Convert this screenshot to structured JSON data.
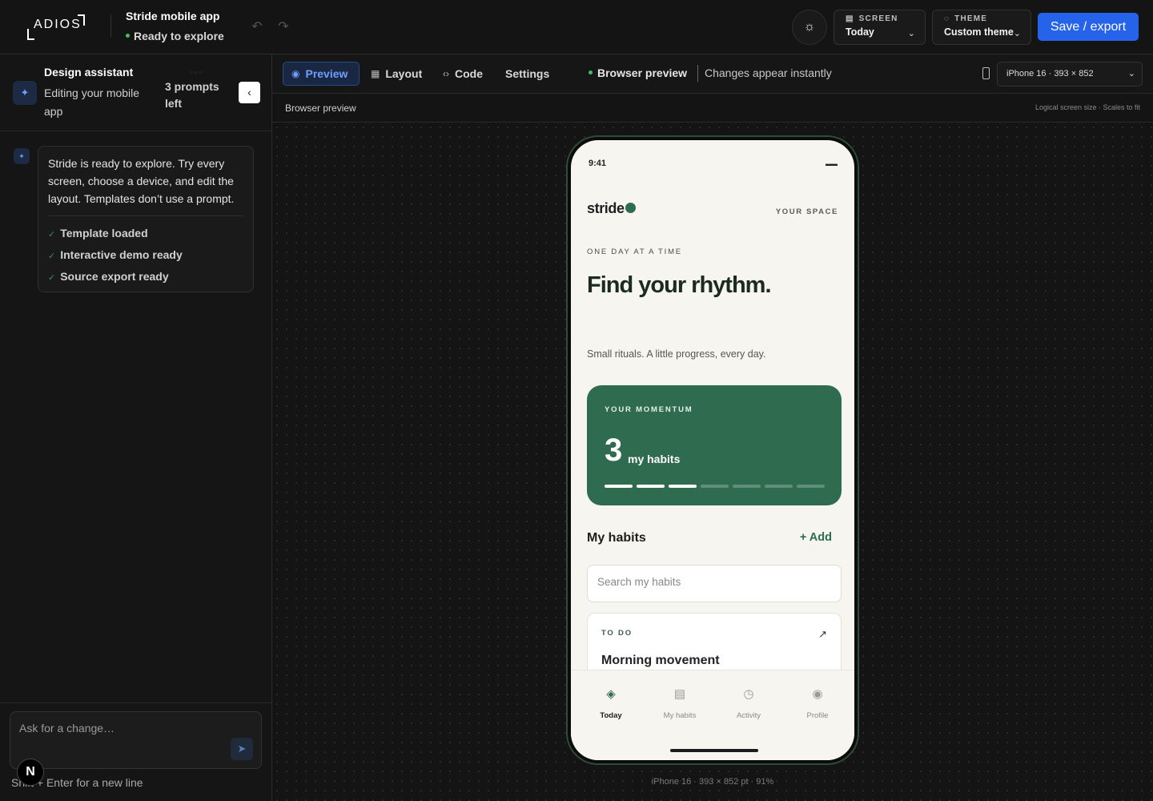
{
  "app": {
    "logo_text": "ADIOS",
    "project_title": "Stride mobile app",
    "project_status": "Ready to explore",
    "colors": {
      "accent": "#2563eb",
      "status_green": "#3fbf6a",
      "brand_green": "#2f6b4f"
    }
  },
  "header": {
    "screen_label": "SCREEN",
    "screen_value": "Today",
    "theme_label": "THEME",
    "theme_value": "Custom theme",
    "save_label": "Save / export",
    "icons": [
      "undo-icon",
      "redo-icon",
      "sun-icon",
      "layout-icon",
      "palette-icon",
      "chevron-down-icon"
    ]
  },
  "assistant": {
    "title": "Design assistant",
    "subtitle": "Editing your mobile app",
    "prompts_left": "3 prompts left",
    "message": "Stride is ready to explore. Try every screen, choose a device, and edit the layout. Templates don’t use a prompt.",
    "checks": [
      "Template loaded",
      "Interactive demo ready",
      "Source export ready"
    ],
    "input_placeholder": "Ask for a change…",
    "hint": "Shift + Enter for a new line",
    "badge": "N"
  },
  "tabs": {
    "items": [
      {
        "label": "Preview",
        "active": true
      },
      {
        "label": "Layout"
      },
      {
        "label": "Code"
      },
      {
        "label": "Settings"
      }
    ],
    "browser_preview": "Browser preview",
    "changes_note": "Changes appear instantly",
    "device": "iPhone 16 · 393 × 852"
  },
  "subbar": {
    "left": "Browser preview",
    "right": "Logical screen size · Scales to fit"
  },
  "canvas": {
    "caption": "iPhone 16 · 393 × 852 pt · 91%"
  },
  "phone": {
    "status_time": "9:41",
    "brand": "stride",
    "your_space": "YOUR SPACE",
    "eyebrow": "ONE DAY AT A TIME",
    "headline": "Find your rhythm.",
    "tagline": "Small rituals. A little progress, every day.",
    "momentum": {
      "label": "YOUR MOMENTUM",
      "count": "3",
      "unit": "my habits",
      "segments_total": 7,
      "segments_done": 3
    },
    "habits": {
      "title": "My habits",
      "add_label": "+ Add",
      "search_placeholder": "Search my habits",
      "card_tag": "TO DO",
      "card_name": "Morning movement"
    },
    "nav": [
      {
        "label": "Today",
        "icon": "diamond-icon",
        "active": true
      },
      {
        "label": "My habits",
        "icon": "list-icon"
      },
      {
        "label": "Activity",
        "icon": "clock-icon"
      },
      {
        "label": "Profile",
        "icon": "profile-icon"
      }
    ]
  }
}
